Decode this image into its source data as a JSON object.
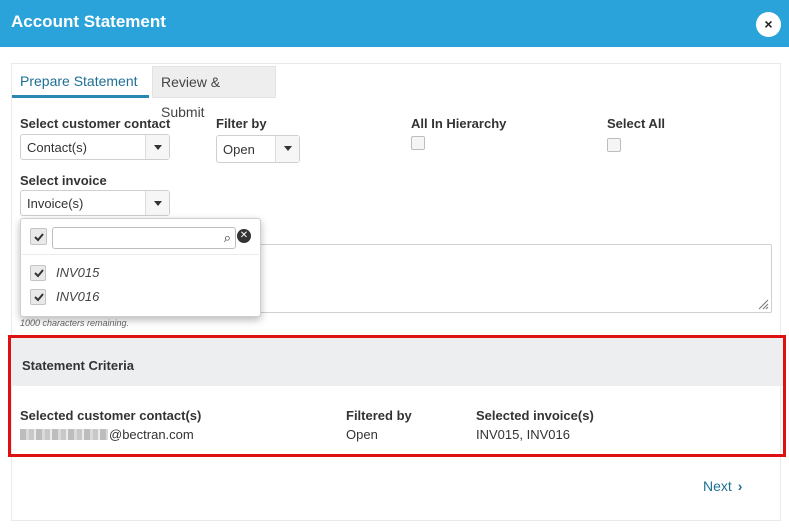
{
  "header": {
    "title": "Account Statement",
    "close_icon": "×"
  },
  "tabs": [
    {
      "label": "Prepare Statement",
      "active": true
    },
    {
      "label": "Review & Submit",
      "active": false
    }
  ],
  "form": {
    "customer_contact": {
      "label": "Select customer contact",
      "value": "Contact(s)"
    },
    "filter_by": {
      "label": "Filter by",
      "value": "Open"
    },
    "all_in_hierarchy": {
      "label": "All In Hierarchy",
      "checked": false
    },
    "select_all": {
      "label": "Select All",
      "checked": false
    },
    "invoice": {
      "label": "Select invoice",
      "value": "Invoice(s)"
    },
    "chars_remaining": "1000 characters remaining."
  },
  "invoice_dropdown": {
    "search_value": "",
    "items": [
      {
        "label": "INV015",
        "checked": true
      },
      {
        "label": "INV016",
        "checked": true
      }
    ]
  },
  "criteria": {
    "title": "Statement Criteria",
    "contact_label": "Selected customer contact(s)",
    "contact_value": "@bectran.com",
    "filter_label": "Filtered by",
    "filter_value": "Open",
    "invoice_label": "Selected invoice(s)",
    "invoice_value": "INV015, INV016"
  },
  "footer": {
    "next_label": "Next"
  },
  "colors": {
    "header_bg": "#29a3d9",
    "highlight_border": "#dd1111",
    "link": "#1f6e96"
  }
}
